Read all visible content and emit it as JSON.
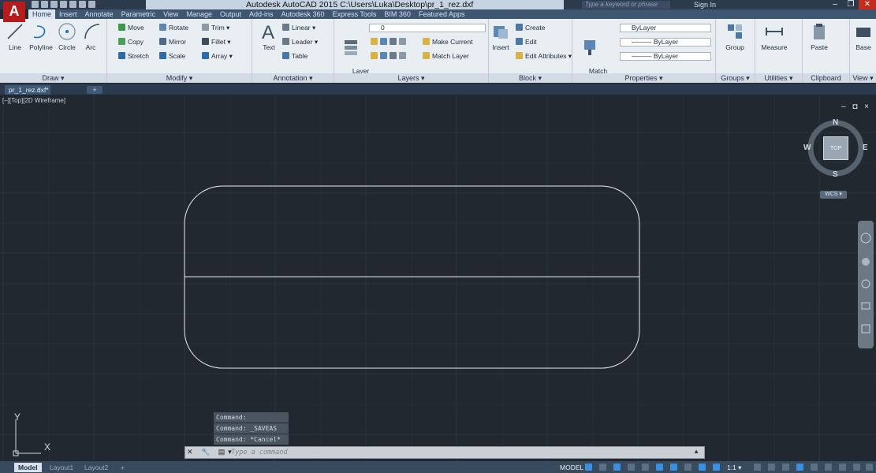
{
  "app": {
    "title": "Autodesk AutoCAD 2015   C:\\Users\\Luka\\Desktop\\pr_1_rez.dxf",
    "logo": "A",
    "search_placeholder": "Type a keyword or phrase",
    "sign_in": "Sign In"
  },
  "ribbon_tabs": [
    "Home",
    "Insert",
    "Annotate",
    "Parametric",
    "View",
    "Manage",
    "Output",
    "Add-ins",
    "Autodesk 360",
    "Express Tools",
    "BIM 360",
    "Featured Apps"
  ],
  "panels": {
    "draw": {
      "title": "Draw ▾",
      "tools": [
        "Line",
        "Polyline",
        "Circle",
        "Arc"
      ]
    },
    "modify": {
      "title": "Modify ▾",
      "tools": [
        "Move",
        "Rotate",
        "Trim ▾",
        "Copy",
        "Mirror",
        "Fillet ▾",
        "Stretch",
        "Scale",
        "Array ▾"
      ]
    },
    "annotation": {
      "title": "Annotation ▾",
      "text": "Text",
      "tools": [
        "Linear ▾",
        "Leader ▾",
        "Table"
      ]
    },
    "layers": {
      "title": "Layers ▾",
      "layer_properties": "Layer\nProperties",
      "current_layer": "0",
      "make_current": "Make Current",
      "match_layer": "Match Layer"
    },
    "block": {
      "title": "Block ▾",
      "insert": "Insert",
      "tools": [
        "Create",
        "Edit",
        "Edit Attributes ▾"
      ]
    },
    "properties": {
      "title": "Properties ▾",
      "match": "Match\nProperties",
      "color": "ByLayer",
      "linetype": "——— ByLayer",
      "lineweight": "——— ByLayer"
    },
    "groups": {
      "title": "Groups ▾",
      "group": "Group"
    },
    "utilities": {
      "title": "Utilities ▾",
      "measure": "Measure"
    },
    "clipboard": {
      "title": "Clipboard",
      "paste": "Paste"
    },
    "view": {
      "title": "View ▾",
      "base": "Base"
    }
  },
  "file_tab": {
    "name": "pr_1_rez.dxf*",
    "new": "+"
  },
  "viewport": {
    "label": "[–][Top][2D Wireframe]",
    "controls": "– ◘ ×"
  },
  "viewcube": {
    "top": "TOP",
    "n": "N",
    "s": "S",
    "e": "E",
    "w": "W",
    "wcs": "WCS ▾"
  },
  "ucs": {
    "x": "X",
    "y": "Y"
  },
  "command_history": [
    "Command:",
    "Command: _SAVEAS",
    "Command: *Cancel*"
  ],
  "command_input": {
    "placeholder": "Type a command",
    "buttons": "✕ 🔧 ▤▾"
  },
  "layout_tabs": [
    "Model",
    "Layout1",
    "Layout2",
    "+"
  ],
  "status": {
    "model": "MODEL",
    "scale": "1:1 ▾"
  },
  "colors": {
    "canvas": "#212830",
    "ribbon": "#e9eef3",
    "accent": "#3f5670"
  }
}
